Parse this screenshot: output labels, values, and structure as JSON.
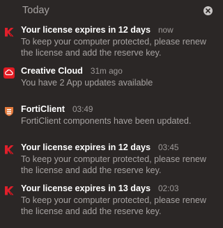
{
  "header": {
    "title": "Today",
    "clear_icon": "close-circle-icon"
  },
  "notifications": [
    {
      "app": "Your license expires in 12 days",
      "time": "now",
      "body": "To keep your computer protected, please renew the license and add the reserve key.",
      "icon": "kaspersky-icon",
      "icon_color": "#e01f2b"
    },
    {
      "app": "Creative Cloud",
      "time": "31m ago",
      "body": "You have 2 App updates available",
      "icon": "creative-cloud-icon",
      "icon_color": "#e21b23"
    },
    {
      "app": "FortiClient",
      "time": "03:49",
      "body": "FortiClient components have been updated.",
      "icon": "forticlient-icon",
      "icon_color": "#e57b3d"
    },
    {
      "app": "Your license expires in 12 days",
      "time": "03:45",
      "body": "To keep your computer protected, please renew the license and add the reserve key.",
      "icon": "kaspersky-icon",
      "icon_color": "#e01f2b"
    },
    {
      "app": "Your license expires in 13 days",
      "time": "02:03",
      "body": "To keep your computer protected, please renew the license and add the reserve key.",
      "icon": "kaspersky-icon",
      "icon_color": "#e01f2b"
    }
  ]
}
